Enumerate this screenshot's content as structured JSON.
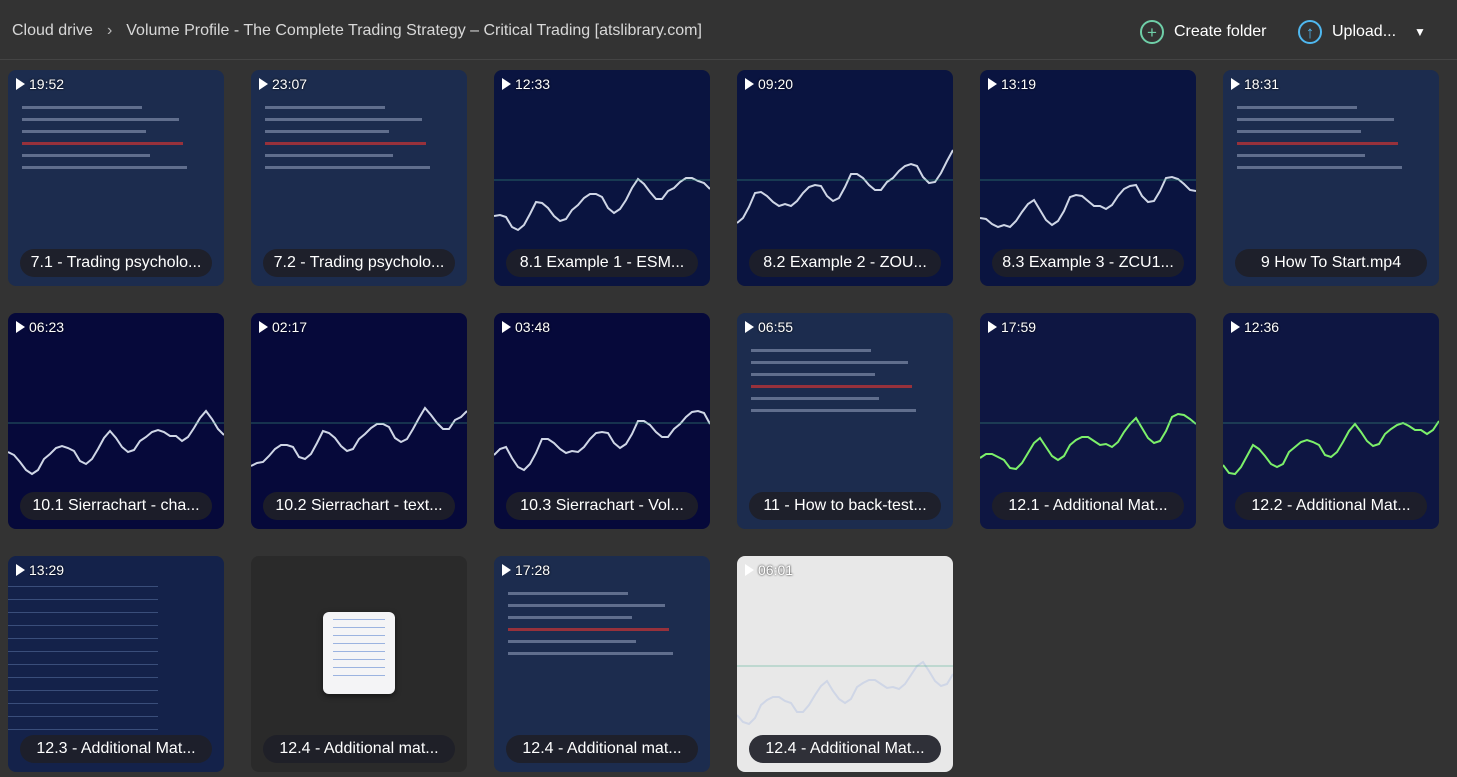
{
  "breadcrumb": {
    "root": "Cloud drive",
    "current": "Volume Profile - The Complete Trading Strategy – Critical Trading [atslibrary.com]"
  },
  "toolbar": {
    "create_folder": "Create folder",
    "upload": "Upload..."
  },
  "colors": {
    "create": "#6fcfa8",
    "upload": "#4fb8f0"
  },
  "files": [
    {
      "duration": "19:52",
      "name": "7.1 - Trading psycholo...",
      "bg": "#1c2c4e",
      "kind": "slide"
    },
    {
      "duration": "23:07",
      "name": "7.2 - Trading psycholo...",
      "bg": "#1c2c4e",
      "kind": "slide"
    },
    {
      "duration": "12:33",
      "name": "8.1 Example 1 - ESM...",
      "bg": "#0a1440",
      "kind": "chart"
    },
    {
      "duration": "09:20",
      "name": "8.2 Example 2 - ZOU...",
      "bg": "#0a1440",
      "kind": "chart"
    },
    {
      "duration": "13:19",
      "name": "8.3 Example 3 - ZCU1...",
      "bg": "#0a1440",
      "kind": "chart"
    },
    {
      "duration": "18:31",
      "name": "9 How To Start.mp4",
      "bg": "#1c2c4e",
      "kind": "slide"
    },
    {
      "duration": "06:23",
      "name": "10.1 Sierrachart - cha...",
      "bg": "#06093a",
      "kind": "chart"
    },
    {
      "duration": "02:17",
      "name": "10.2 Sierrachart - text...",
      "bg": "#06093a",
      "kind": "chart"
    },
    {
      "duration": "03:48",
      "name": "10.3 Sierrachart - Vol...",
      "bg": "#06093a",
      "kind": "chart"
    },
    {
      "duration": "06:55",
      "name": "11 - How to back-test...",
      "bg": "#1c2c4e",
      "kind": "slide"
    },
    {
      "duration": "17:59",
      "name": "12.1 - Additional Mat...",
      "bg": "#0e1642",
      "kind": "line"
    },
    {
      "duration": "12:36",
      "name": "12.2 - Additional Mat...",
      "bg": "#0e1642",
      "kind": "line"
    },
    {
      "duration": "13:29",
      "name": "12.3 - Additional Mat...",
      "bg": "#14224a",
      "kind": "table"
    },
    {
      "duration": "",
      "name": "12.4 - Additional mat...",
      "bg": "#2a2a2a",
      "kind": "doc"
    },
    {
      "duration": "17:28",
      "name": "12.4 - Additional mat...",
      "bg": "#1c2c4e",
      "kind": "slide"
    },
    {
      "duration": "06:01",
      "name": "12.4 - Additional Mat...",
      "bg": "#e8e8e8",
      "kind": "chart"
    }
  ]
}
